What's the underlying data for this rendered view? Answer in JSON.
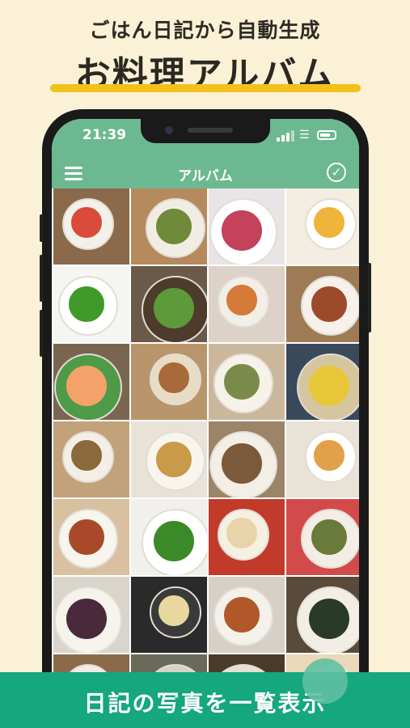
{
  "promo": {
    "subtitle": "ごはん日記から自動生成",
    "title": "お料理アルバム",
    "banner": "日記の写真を一覧表示"
  },
  "status_bar": {
    "time": "21:39"
  },
  "nav": {
    "title": "アルバム",
    "menu_icon": "hamburger-icon",
    "confirm_icon": "check-circle-icon"
  },
  "colors": {
    "background": "#fbf1d6",
    "accent_yellow": "#f2c11c",
    "header_green": "#6cb890",
    "banner_green": "#15a77d"
  },
  "album": {
    "photos": [
      {
        "name": "salad-and-side-dishes",
        "bg": "#8a6a4a",
        "plate": "#f4f1ea",
        "food": "#d84a3a"
      },
      {
        "name": "japanese-set-meal",
        "bg": "#b58a5c",
        "plate": "#f2ede4",
        "food": "#6f8a3a"
      },
      {
        "name": "octopus-dish",
        "bg": "#e9e4e6",
        "plate": "#ffffff",
        "food": "#c4425a"
      },
      {
        "name": "plated-dessert",
        "bg": "#f3ede2",
        "plate": "#ffffff",
        "food": "#f0b43a"
      },
      {
        "name": "broccoli-greens",
        "bg": "#f5f5f2",
        "plate": "#ffffff",
        "food": "#3f9a2a"
      },
      {
        "name": "cucumber-stir-fry",
        "bg": "#6b5a48",
        "plate": "#4d3b2c",
        "food": "#5c9a3a"
      },
      {
        "name": "pizza",
        "bg": "#dcd2c8",
        "plate": "#f2eee8",
        "food": "#d67a3a"
      },
      {
        "name": "burger-and-bacon",
        "bg": "#9e7a55",
        "plate": "#f6f1ea",
        "food": "#9c4a2a"
      },
      {
        "name": "noodle-salad",
        "bg": "#7a6650",
        "plate": "#4e9a48",
        "food": "#f3a36a"
      },
      {
        "name": "rice-and-sides",
        "bg": "#b8956a",
        "plate": "#e9dcc4",
        "food": "#a86a3a"
      },
      {
        "name": "assorted-bowls",
        "bg": "#cbb89c",
        "plate": "#f6f2ea",
        "food": "#7a8a4a"
      },
      {
        "name": "pineapple-slices",
        "bg": "#3a4a5a",
        "plate": "#d6c6a0",
        "food": "#e8c63a"
      },
      {
        "name": "small-plates",
        "bg": "#c2a27a",
        "plate": "#f4efe6",
        "food": "#8a6a3a"
      },
      {
        "name": "stir-fried-cabbage",
        "bg": "#e8e2d8",
        "plate": "#f8f5ef",
        "food": "#c99a4a"
      },
      {
        "name": "dinner-spread",
        "bg": "#9c8468",
        "plate": "#f3eee6",
        "food": "#7a5a3a"
      },
      {
        "name": "pancake",
        "bg": "#e9e2d6",
        "plate": "#ffffff",
        "food": "#e2a048"
      },
      {
        "name": "pork-cutlet",
        "bg": "#d8c0a0",
        "plate": "#f8f4ee",
        "food": "#a84a2a"
      },
      {
        "name": "rapini-greens",
        "bg": "#f2f0ec",
        "plate": "#ffffff",
        "food": "#3a8a2a"
      },
      {
        "name": "ramen",
        "bg": "#c23a2a",
        "plate": "#f6f0e2",
        "food": "#e8d4a8"
      },
      {
        "name": "rice-bowl-and-sides",
        "bg": "#d24a4a",
        "plate": "#f3ede5",
        "food": "#6a7a3a"
      },
      {
        "name": "eggplant-dish",
        "bg": "#d9d4cc",
        "plate": "#f6f2ec",
        "food": "#4a2a3a"
      },
      {
        "name": "simmered-potatoes",
        "bg": "#2a2a2a",
        "plate": "#3a3a3a",
        "food": "#e8d8a0"
      },
      {
        "name": "meat-rolls",
        "bg": "#d6d0c6",
        "plate": "#f4f0ea",
        "food": "#b0582a"
      },
      {
        "name": "sushi-rolls",
        "bg": "#5a4a3a",
        "plate": "#f2eee6",
        "food": "#2a3a2a"
      },
      {
        "name": "mixed-side-dish",
        "bg": "#8a6a4a",
        "plate": "#f1ece4",
        "food": "#c07a4a"
      },
      {
        "name": "seaweed-salad",
        "bg": "#6a6a5a",
        "plate": "#d8d2c6",
        "food": "#3a5a3a"
      },
      {
        "name": "soup-bowl",
        "bg": "#4a3a2a",
        "plate": "#e8e0d2",
        "food": "#c8a060"
      },
      {
        "name": "omelette",
        "bg": "#ead8b8",
        "plate": "#f8f2e4",
        "food": "#f0c050"
      }
    ]
  }
}
